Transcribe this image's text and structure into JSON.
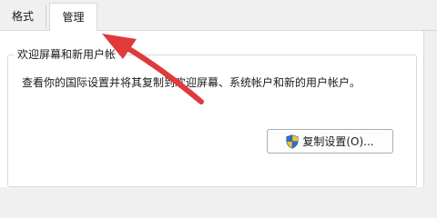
{
  "tabs": [
    {
      "label": "格式"
    },
    {
      "label": "管理"
    }
  ],
  "group": {
    "title": "欢迎屏幕和新用户帐",
    "description": "查看你的国际设置并将其复制到欢迎屏幕、系统帐户和新的用户帐户。"
  },
  "copy_button": {
    "label": "复制设置(O)..."
  },
  "colors": {
    "annotation_arrow": "#e03a3a",
    "shield_blue": "#2f6fd0",
    "shield_yellow": "#f2c230"
  },
  "icons": {
    "button_icon": "uac-shield-icon",
    "annotation": "red-arrow-icon"
  }
}
